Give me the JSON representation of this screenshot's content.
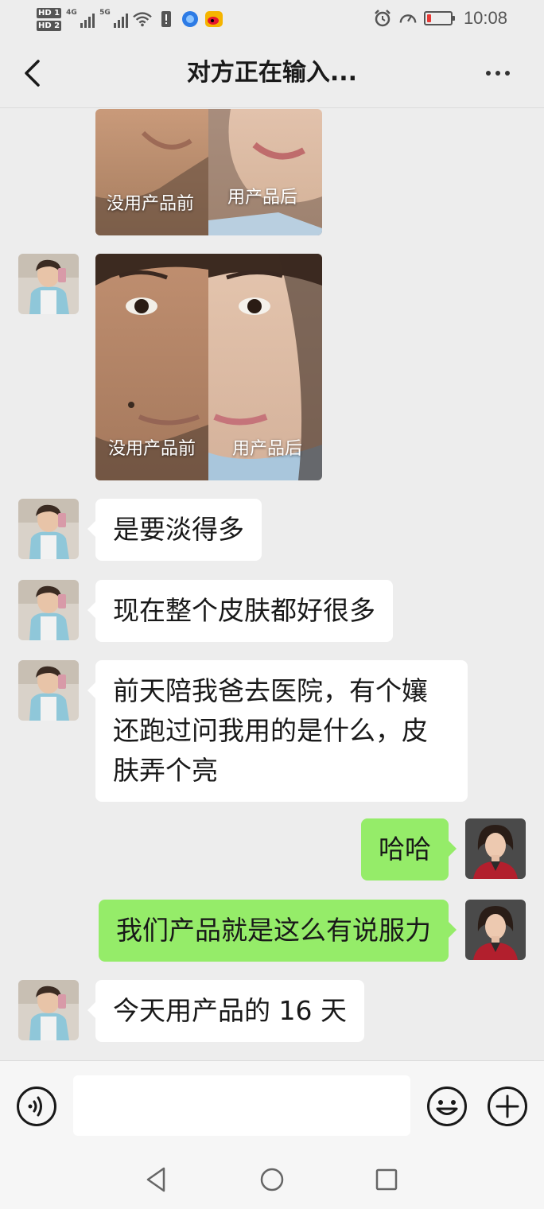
{
  "status_bar": {
    "hd1": "HD 1",
    "hd2": "HD 2",
    "net1": "4G",
    "net2": "5G",
    "time": "10:08",
    "battery_level": 0.18,
    "battery_color": "#e53935",
    "icons": [
      "wifi-icon",
      "sim-alert-icon",
      "browser-icon",
      "weibo-icon",
      "alarm-icon",
      "speed-icon",
      "battery-icon"
    ]
  },
  "header": {
    "title": "对方正在输入...",
    "back_icon": "chevron-left-icon",
    "more_icon": "more-dots-icon"
  },
  "messages": [
    {
      "from": "friend",
      "type": "image",
      "captions": [
        "没用产品前",
        "用产品后"
      ]
    },
    {
      "from": "friend",
      "type": "image",
      "captions": [
        "没用产品前",
        "用产品后"
      ]
    },
    {
      "from": "friend",
      "type": "text",
      "text": "是要淡得多"
    },
    {
      "from": "friend",
      "type": "text",
      "text": "现在整个皮肤都好很多"
    },
    {
      "from": "friend",
      "type": "text",
      "text": "前天陪我爸去医院，有个孃还跑过问我用的是什么，皮肤弄个亮"
    },
    {
      "from": "me",
      "type": "text",
      "text": "哈哈"
    },
    {
      "from": "me",
      "type": "text",
      "text": "我们产品就是这么有说服力"
    },
    {
      "from": "friend",
      "type": "text",
      "text": "今天用产品的 16 天"
    }
  ],
  "input_bar": {
    "placeholder": "",
    "voice_icon": "voice-icon",
    "emoji_icon": "emoji-icon",
    "plus_icon": "plus-icon"
  },
  "colors": {
    "background": "#ededed",
    "incoming_bubble": "#ffffff",
    "outgoing_bubble": "#95ec69"
  },
  "nav_bar": {
    "icons": [
      "nav-back-icon",
      "nav-home-icon",
      "nav-recent-icon"
    ]
  }
}
